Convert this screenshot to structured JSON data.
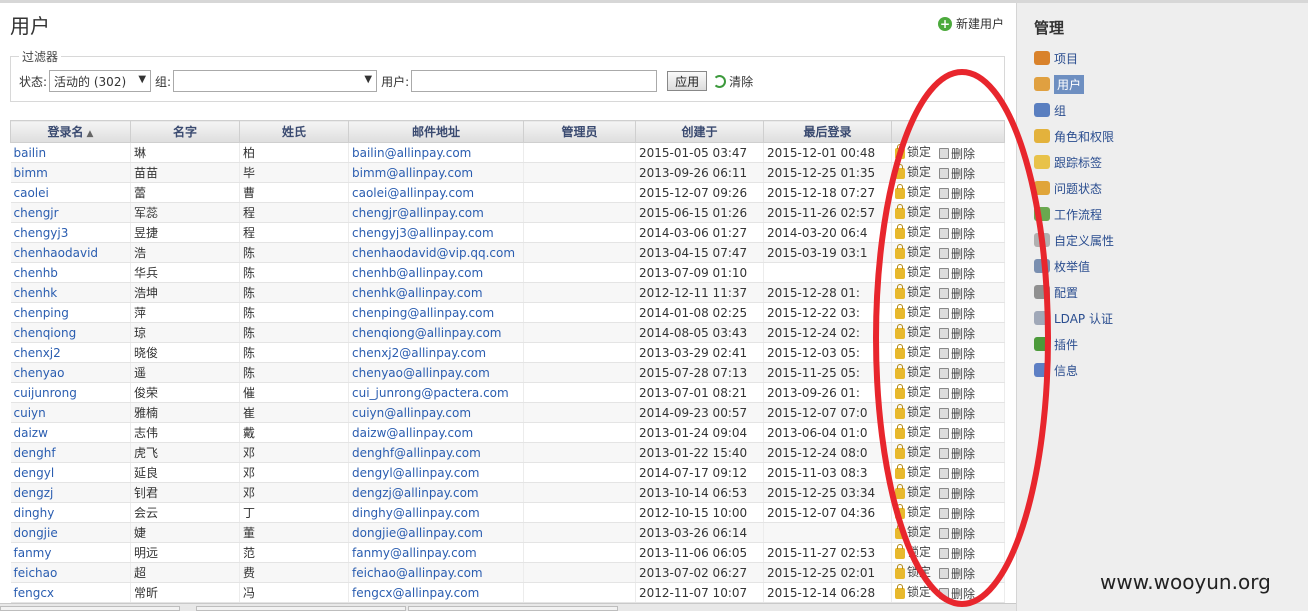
{
  "header": {
    "title": "用户",
    "new_user": "新建用户"
  },
  "filter": {
    "legend": "过滤器",
    "status_label": "状态:",
    "status_value": "活动的 (302)",
    "group_label": "组:",
    "group_value": "",
    "user_label": "用户:",
    "user_value": "",
    "apply": "应用",
    "clear": "清除"
  },
  "table": {
    "headers": [
      "登录名",
      "名字",
      "姓氏",
      "邮件地址",
      "管理员",
      "创建于",
      "最后登录",
      ""
    ],
    "lock_label": "锁定",
    "delete_label": "删除",
    "rows": [
      [
        "bailin",
        "琳",
        "柏",
        "bailin@allinpay.com",
        "2015-01-05 03:47",
        "2015-12-01 00:48"
      ],
      [
        "bimm",
        "苗苗",
        "毕",
        "bimm@allinpay.com",
        "2013-09-26 06:11",
        "2015-12-25 01:35"
      ],
      [
        "caolei",
        "蕾",
        "曹",
        "caolei@allinpay.com",
        "2015-12-07 09:26",
        "2015-12-18 07:27"
      ],
      [
        "chengjr",
        "军蕊",
        "程",
        "chengjr@allinpay.com",
        "2015-06-15 01:26",
        "2015-11-26 02:57"
      ],
      [
        "chengyj3",
        "昱捷",
        "程",
        "chengyj3@allinpay.com",
        "2014-03-06 01:27",
        "2014-03-20 06:4"
      ],
      [
        "chenhaodavid",
        "浩",
        "陈",
        "chenhaodavid@vip.qq.com",
        "2013-04-15 07:47",
        "2015-03-19 03:1"
      ],
      [
        "chenhb",
        "华兵",
        "陈",
        "chenhb@allinpay.com",
        "2013-07-09 01:10",
        ""
      ],
      [
        "chenhk",
        "浩坤",
        "陈",
        "chenhk@allinpay.com",
        "2012-12-11 11:37",
        "2015-12-28 01:"
      ],
      [
        "chenping",
        "萍",
        "陈",
        "chenping@allinpay.com",
        "2014-01-08 02:25",
        "2015-12-22 03:"
      ],
      [
        "chenqiong",
        "琼",
        "陈",
        "chenqiong@allinpay.com",
        "2014-08-05 03:43",
        "2015-12-24 02:"
      ],
      [
        "chenxj2",
        "晓俊",
        "陈",
        "chenxj2@allinpay.com",
        "2013-03-29 02:41",
        "2015-12-03 05:"
      ],
      [
        "chenyao",
        "遥",
        "陈",
        "chenyao@allinpay.com",
        "2015-07-28 07:13",
        "2015-11-25 05:"
      ],
      [
        "cuijunrong",
        "俊荣",
        "催",
        "cui_junrong@pactera.com",
        "2013-07-01 08:21",
        "2013-09-26 01:"
      ],
      [
        "cuiyn",
        "雅楠",
        "崔",
        "cuiyn@allinpay.com",
        "2014-09-23 00:57",
        "2015-12-07 07:0"
      ],
      [
        "daizw",
        "志伟",
        "戴",
        "daizw@allinpay.com",
        "2013-01-24 09:04",
        "2013-06-04 01:0"
      ],
      [
        "denghf",
        "虎飞",
        "邓",
        "denghf@allinpay.com",
        "2013-01-22 15:40",
        "2015-12-24 08:0"
      ],
      [
        "dengyl",
        "延良",
        "邓",
        "dengyl@allinpay.com",
        "2014-07-17 09:12",
        "2015-11-03 08:3"
      ],
      [
        "dengzj",
        "钊君",
        "邓",
        "dengzj@allinpay.com",
        "2013-10-14 06:53",
        "2015-12-25 03:34"
      ],
      [
        "dinghy",
        "会云",
        "丁",
        "dinghy@allinpay.com",
        "2012-10-15 10:00",
        "2015-12-07 04:36"
      ],
      [
        "dongjie",
        "婕",
        "董",
        "dongjie@allinpay.com",
        "2013-03-26 06:14",
        ""
      ],
      [
        "fanmy",
        "明远",
        "范",
        "fanmy@allinpay.com",
        "2013-11-06 06:05",
        "2015-11-27 02:53"
      ],
      [
        "feichao",
        "超",
        "费",
        "feichao@allinpay.com",
        "2013-07-02 06:27",
        "2015-12-25 02:01"
      ],
      [
        "fengcx",
        "常昕",
        "冯",
        "fengcx@allinpay.com",
        "2012-11-07 10:07",
        "2015-12-14 06:28"
      ]
    ]
  },
  "sidebar": {
    "title": "管理",
    "items": [
      {
        "label": "项目",
        "icon": "projects-icon",
        "color": "#d9822b"
      },
      {
        "label": "用户",
        "icon": "user-icon",
        "color": "#e0a040"
      },
      {
        "label": "组",
        "icon": "group-icon",
        "color": "#5a7fc0"
      },
      {
        "label": "角色和权限",
        "icon": "roles-icon",
        "color": "#e3b23c"
      },
      {
        "label": "跟踪标签",
        "icon": "tracker-icon",
        "color": "#e8c24a"
      },
      {
        "label": "问题状态",
        "icon": "issue-status-icon",
        "color": "#e0a53a"
      },
      {
        "label": "工作流程",
        "icon": "workflow-icon",
        "color": "#6aa84f"
      },
      {
        "label": "自定义属性",
        "icon": "custom-fields-icon",
        "color": "#b0b0b0"
      },
      {
        "label": "枚举值",
        "icon": "enumerations-icon",
        "color": "#7a8fb0"
      },
      {
        "label": "配置",
        "icon": "settings-icon",
        "color": "#909090"
      },
      {
        "label": "LDAP 认证",
        "icon": "ldap-icon",
        "color": "#a0a8b8"
      },
      {
        "label": "插件",
        "icon": "plugin-icon",
        "color": "#4c9a3a"
      },
      {
        "label": "信息",
        "icon": "info-icon",
        "color": "#5d7fc4"
      }
    ],
    "active_index": 1
  },
  "watermark": "www.wooyun.org"
}
